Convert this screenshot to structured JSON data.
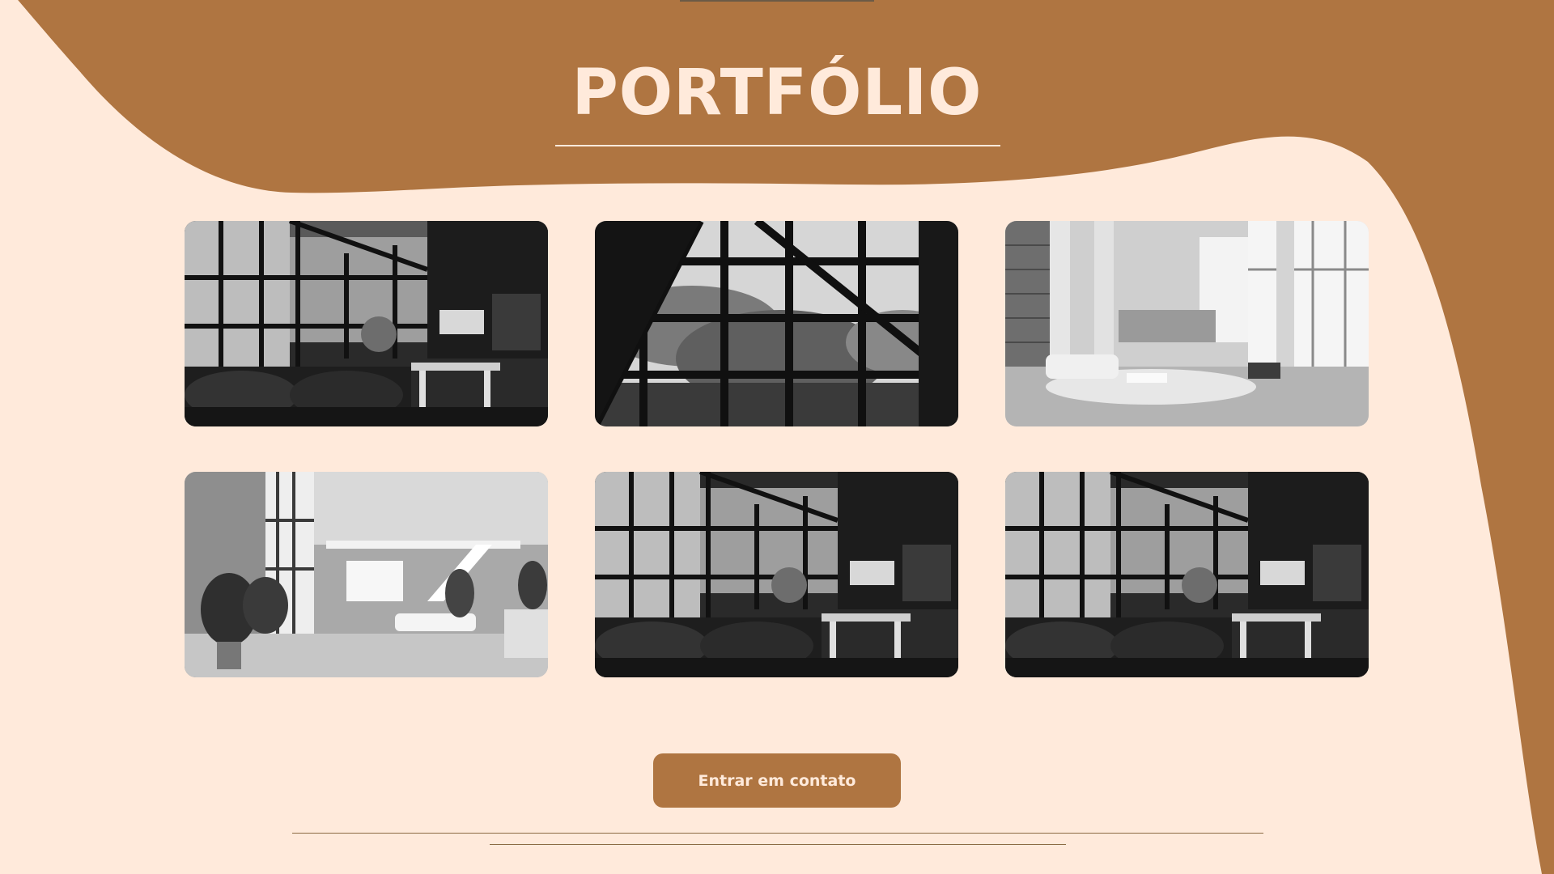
{
  "page": {
    "title": "PORTFÓLIO",
    "cta_label": "Entrar em contato"
  },
  "colors": {
    "background": "#FFEADB",
    "accent": "#AF7541",
    "title_text": "#FFEADB"
  },
  "gallery": [
    {
      "subject": "loft living room with leather sofa and kitchen island, black and white"
    },
    {
      "subject": "steel frame windows with trees outside, black and white"
    },
    {
      "subject": "bright double-height living room with bookshelves, black and white"
    },
    {
      "subject": "white modern interior with plants and staircase, black and white"
    },
    {
      "subject": "loft living room with leather sofa and kitchen island, black and white"
    },
    {
      "subject": "loft living room with leather sofa and kitchen island, black and white"
    }
  ]
}
